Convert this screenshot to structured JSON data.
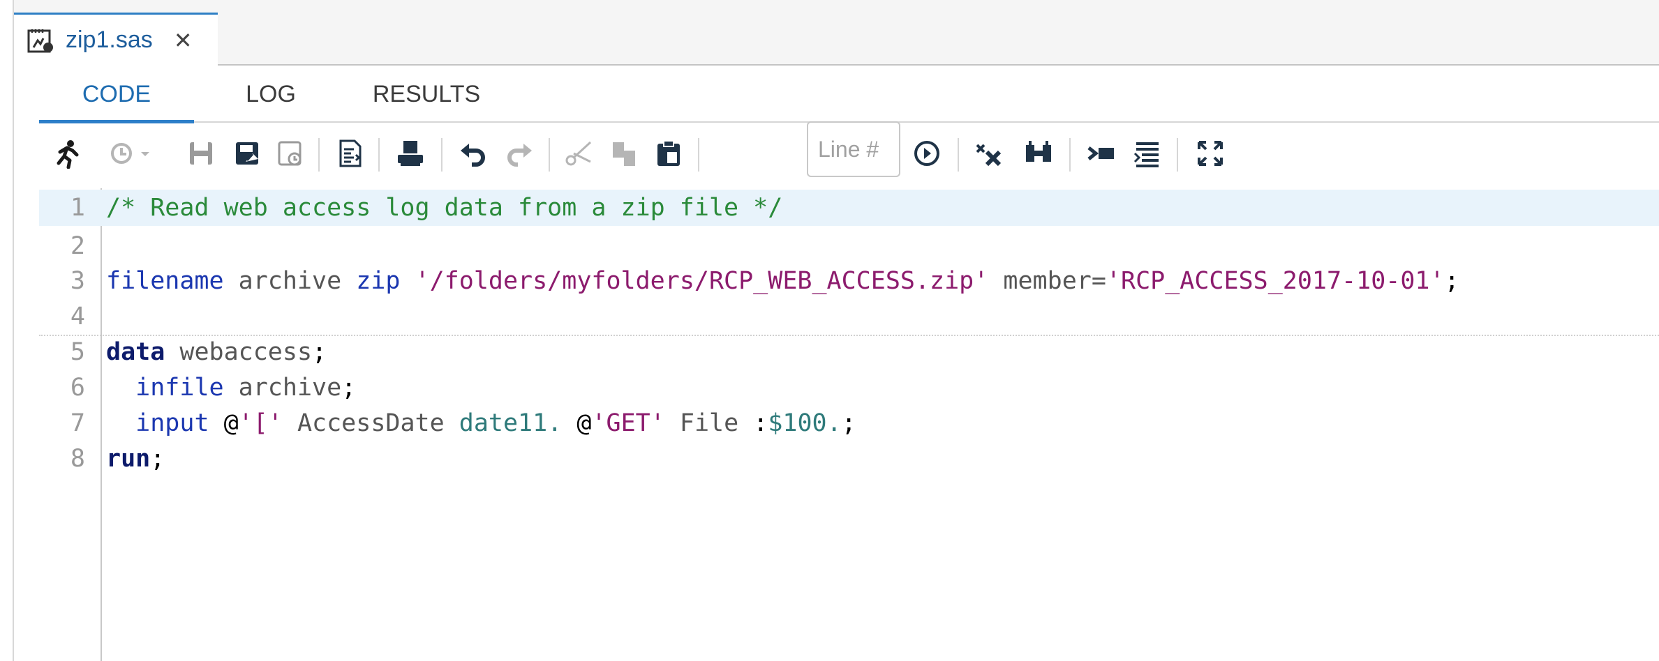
{
  "file_tab": {
    "name": "zip1.sas",
    "icon": "sas-program-icon",
    "close_label": "✕"
  },
  "subtabs": [
    {
      "label": "CODE",
      "active": true
    },
    {
      "label": "LOG",
      "active": false
    },
    {
      "label": "RESULTS",
      "active": false
    }
  ],
  "toolbar": {
    "line_placeholder": "Line #",
    "icons": [
      "run-icon",
      "history-icon",
      "save-icon",
      "save-as-icon",
      "save-to-icon",
      "format-code-icon",
      "print-icon",
      "undo-icon",
      "redo-icon",
      "cut-icon",
      "copy-icon",
      "paste-icon",
      "go-to-line-icon",
      "clear-code-icon",
      "find-replace-icon",
      "insert-snippet-icon",
      "format-list-icon",
      "maximize-icon"
    ]
  },
  "code_lines": [
    {
      "n": "1",
      "tokens": [
        {
          "t": "/* Read web access log data from a zip file */",
          "c": "cm"
        }
      ]
    },
    {
      "n": "2",
      "tokens": []
    },
    {
      "n": "3",
      "tokens": [
        {
          "t": "filename",
          "c": "kw"
        },
        {
          "t": " archive ",
          "c": "pl"
        },
        {
          "t": "zip",
          "c": "kw"
        },
        {
          "t": " ",
          "c": "pl"
        },
        {
          "t": "'/folders/myfolders/RCP_WEB_ACCESS.zip'",
          "c": "st"
        },
        {
          "t": " member=",
          "c": "pl"
        },
        {
          "t": "'RCP_ACCESS_2017-10-01'",
          "c": "st"
        },
        {
          "t": ";",
          "c": "op"
        }
      ]
    },
    {
      "n": "4",
      "tokens": []
    },
    {
      "n": "5",
      "tokens": [
        {
          "t": "data",
          "c": "kwb"
        },
        {
          "t": " webaccess",
          "c": "pl"
        },
        {
          "t": ";",
          "c": "op"
        }
      ]
    },
    {
      "n": "6",
      "tokens": [
        {
          "t": "  ",
          "c": "pl"
        },
        {
          "t": "infile",
          "c": "kw"
        },
        {
          "t": " archive",
          "c": "pl"
        },
        {
          "t": ";",
          "c": "op"
        }
      ]
    },
    {
      "n": "7",
      "tokens": [
        {
          "t": "  ",
          "c": "pl"
        },
        {
          "t": "input",
          "c": "kw"
        },
        {
          "t": " ",
          "c": "pl"
        },
        {
          "t": "@",
          "c": "op"
        },
        {
          "t": "'['",
          "c": "st"
        },
        {
          "t": " AccessDate ",
          "c": "pl"
        },
        {
          "t": "date11.",
          "c": "nm"
        },
        {
          "t": " ",
          "c": "pl"
        },
        {
          "t": "@",
          "c": "op"
        },
        {
          "t": "'GET'",
          "c": "st"
        },
        {
          "t": " File ",
          "c": "pl"
        },
        {
          "t": ":",
          "c": "op"
        },
        {
          "t": "$100.",
          "c": "nm"
        },
        {
          "t": ";",
          "c": "op"
        }
      ]
    },
    {
      "n": "8",
      "tokens": [
        {
          "t": "run",
          "c": "kwb"
        },
        {
          "t": ";",
          "c": "op"
        }
      ]
    }
  ],
  "colors": {
    "accent": "#2d7fc9",
    "current_line": "#e8f3fb",
    "comment": "#2a8a3a",
    "keyword": "#1b37b0",
    "string": "#8c1b6d"
  }
}
